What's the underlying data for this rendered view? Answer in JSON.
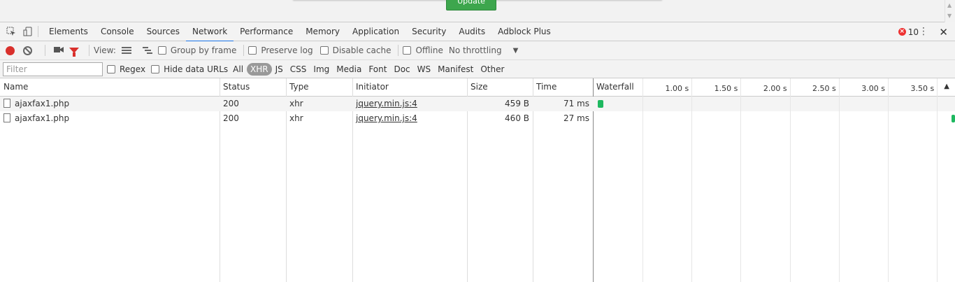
{
  "page": {
    "button_label": "Update"
  },
  "tabs": [
    {
      "label": "Elements"
    },
    {
      "label": "Console"
    },
    {
      "label": "Sources"
    },
    {
      "label": "Network"
    },
    {
      "label": "Performance"
    },
    {
      "label": "Memory"
    },
    {
      "label": "Application"
    },
    {
      "label": "Security"
    },
    {
      "label": "Audits"
    },
    {
      "label": "Adblock Plus"
    }
  ],
  "active_tab": "Network",
  "errors": {
    "count": "10"
  },
  "toolbar": {
    "view_label": "View:",
    "group_by_frame": "Group by frame",
    "preserve_log": "Preserve log",
    "disable_cache": "Disable cache",
    "offline": "Offline",
    "throttling": "No throttling"
  },
  "filter": {
    "placeholder": "Filter",
    "regex": "Regex",
    "hide_data_urls": "Hide data URLs",
    "types": [
      "All",
      "XHR",
      "JS",
      "CSS",
      "Img",
      "Media",
      "Font",
      "Doc",
      "WS",
      "Manifest",
      "Other"
    ],
    "active_type": "XHR"
  },
  "columns": {
    "name": "Name",
    "status": "Status",
    "type": "Type",
    "initiator": "Initiator",
    "size": "Size",
    "time": "Time",
    "waterfall": "Waterfall"
  },
  "waterfall_ticks": [
    "1.00 s",
    "1.50 s",
    "2.00 s",
    "2.50 s",
    "3.00 s",
    "3.50 s"
  ],
  "rows": [
    {
      "name": "ajaxfax1.php",
      "status": "200",
      "type": "xhr",
      "initiator": "jquery.min.js:4",
      "size": "459 B",
      "time": "71 ms"
    },
    {
      "name": "ajaxfax1.php",
      "status": "200",
      "type": "xhr",
      "initiator": "jquery.min.js:4",
      "size": "460 B",
      "time": "27 ms"
    }
  ],
  "colors": {
    "record": "#d9302c",
    "active_tab_underline": "#1a73e8",
    "waterfall_bar": "#1eb85f",
    "page_button": "#3da64d"
  }
}
